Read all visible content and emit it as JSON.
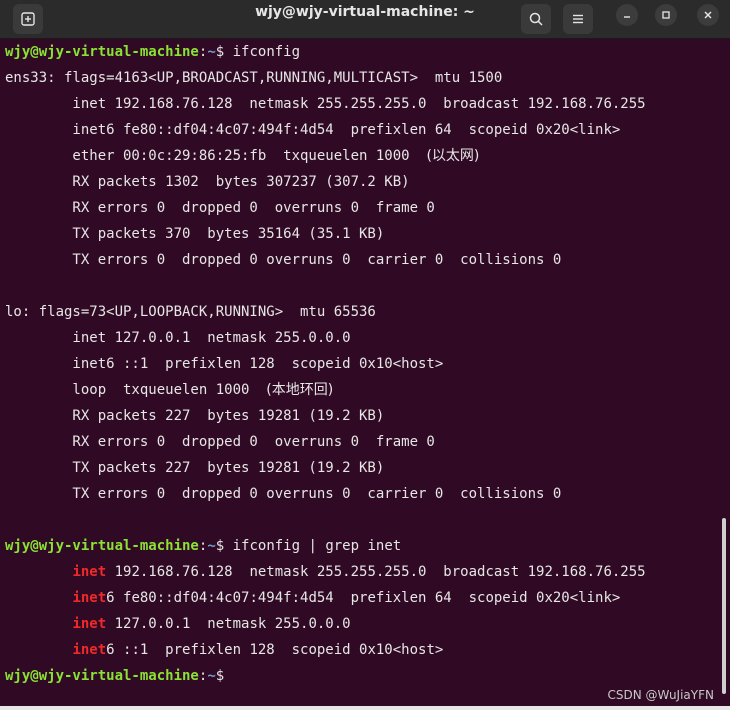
{
  "window": {
    "title": "wjy@wjy-virtual-machine: ~",
    "new_tab_icon": "new-tab-icon",
    "search_icon": "search-icon",
    "menu_icon": "hamburger-menu-icon",
    "minimize_icon": "minimize-icon",
    "maximize_icon": "maximize-icon",
    "close_icon": "close-icon"
  },
  "terminal": {
    "prompt": {
      "user": "wjy@wjy-virtual-machine",
      "sep": ":",
      "path": "~",
      "sigil": "$ "
    },
    "cmd1": "ifconfig",
    "ens33": {
      "header": "ens33: flags=4163<UP,BROADCAST,RUNNING,MULTICAST>  mtu 1500",
      "inet": "        inet 192.168.76.128  netmask 255.255.255.0  broadcast 192.168.76.255",
      "inet6": "        inet6 fe80::df04:4c07:494f:4d54  prefixlen 64  scopeid 0x20<link>",
      "ether_prefix": "        ether 00:0c:29:86:25:fb  txqueuelen 1000  ",
      "ether_cjk": "(以太网)",
      "rx_packets": "        RX packets 1302  bytes 307237 (307.2 KB)",
      "rx_errors": "        RX errors 0  dropped 0  overruns 0  frame 0",
      "tx_packets": "        TX packets 370  bytes 35164 (35.1 KB)",
      "tx_errors": "        TX errors 0  dropped 0 overruns 0  carrier 0  collisions 0"
    },
    "lo": {
      "header": "lo: flags=73<UP,LOOPBACK,RUNNING>  mtu 65536",
      "inet": "        inet 127.0.0.1  netmask 255.0.0.0",
      "inet6": "        inet6 ::1  prefixlen 128  scopeid 0x10<host>",
      "loop_prefix": "        loop  txqueuelen 1000  ",
      "loop_cjk": "(本地环回)",
      "rx_packets": "        RX packets 227  bytes 19281 (19.2 KB)",
      "rx_errors": "        RX errors 0  dropped 0  overruns 0  frame 0",
      "tx_packets": "        TX packets 227  bytes 19281 (19.2 KB)",
      "tx_errors": "        TX errors 0  dropped 0 overruns 0  carrier 0  collisions 0"
    },
    "cmd2": "ifconfig | grep inet",
    "grep": {
      "indent": "        ",
      "match": "inet",
      "line1_rest": " 192.168.76.128  netmask 255.255.255.0  broadcast 192.168.76.255",
      "line2_rest": "6 fe80::df04:4c07:494f:4d54  prefixlen 64  scopeid 0x20<link>",
      "line3_rest": " 127.0.0.1  netmask 255.0.0.0",
      "line4_rest": "6 ::1  prefixlen 128  scopeid 0x10<host>"
    }
  },
  "watermark": "CSDN @WuJiaYFN",
  "colors": {
    "background": "#300a24",
    "prompt_user": "#8ae234",
    "prompt_path": "#729fcf",
    "grep_match": "#ef2929"
  }
}
